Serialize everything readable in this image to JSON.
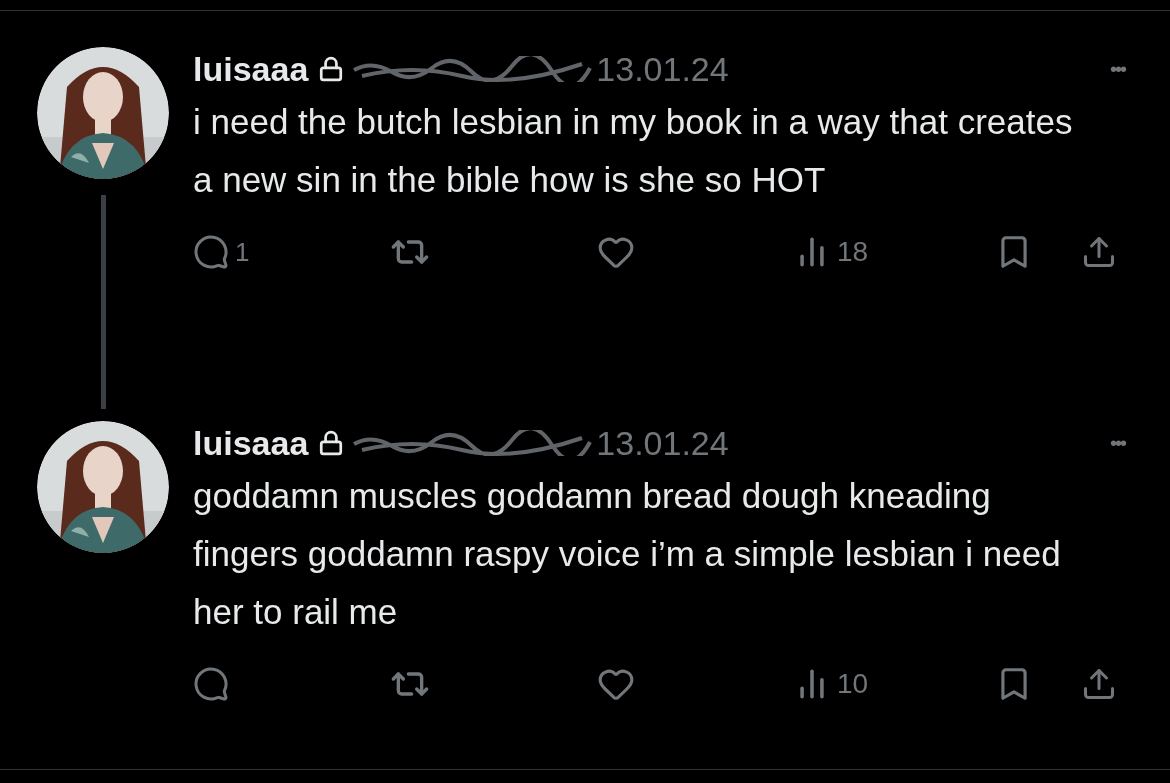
{
  "tweets": [
    {
      "author": "luisaaa",
      "time": "13.01.24",
      "more": "•••",
      "text": "i need the butch lesbian in my book in a way that creates a new sin in the bible how is she so HOT",
      "replies": "1",
      "views": "18",
      "thread_line": true
    },
    {
      "author": "luisaaa",
      "time": "13.01.24",
      "more": "•••",
      "text": "goddamn muscles goddamn bread dough kneading fingers goddamn raspy voice i’m a simple lesbian i need her to rail me",
      "views": "10",
      "thread_line": false
    }
  ]
}
